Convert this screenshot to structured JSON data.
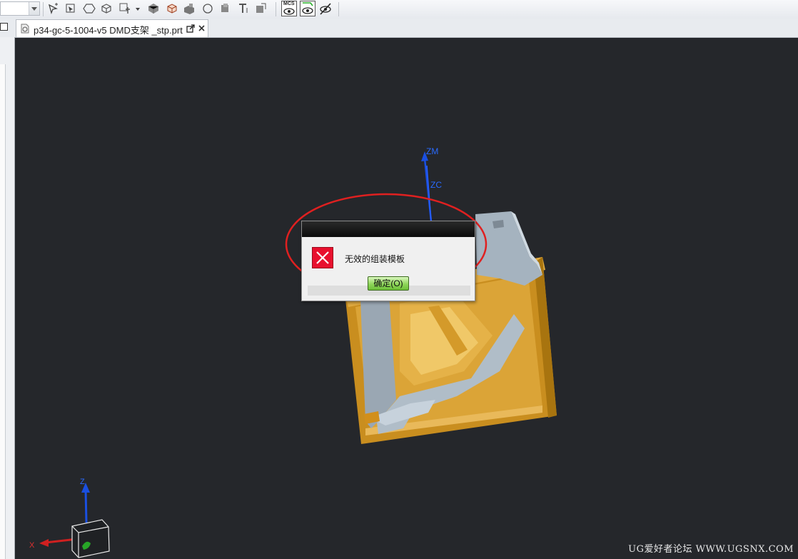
{
  "toolbar": {
    "selection_filter_value": "",
    "icons": [
      "selection-arrow-icon",
      "snap-point-icon",
      "polygon-icon",
      "solid-body-icon",
      "component-icon",
      "dropdown-icon",
      "shaded-cube-icon",
      "edged-cube-icon",
      "block-icon",
      "circle-icon",
      "feature-icon",
      "text-icon",
      "layer-icon",
      "wcs-display-icon",
      "show-icon",
      "hide-icon"
    ],
    "mcs_label": "MCS"
  },
  "tab": {
    "title": "p34-gc-5-1004-v5 DMD支架 _stp.prt"
  },
  "viewport": {
    "background": "#25272b",
    "axes_labels": {
      "zm": "ZM",
      "zc": "ZC"
    },
    "triad_labels": {
      "z": "Z",
      "x": "X"
    },
    "part_colors": {
      "body": "#d9a233",
      "face": "#e8b54a",
      "cut": "#aab8c4"
    },
    "annotation_color": "#e02020"
  },
  "dialog": {
    "message": "无效的组装模板",
    "ok_label": "确定(O)"
  },
  "watermark": "UG爱好者论坛 WWW.UGSNX.COM"
}
